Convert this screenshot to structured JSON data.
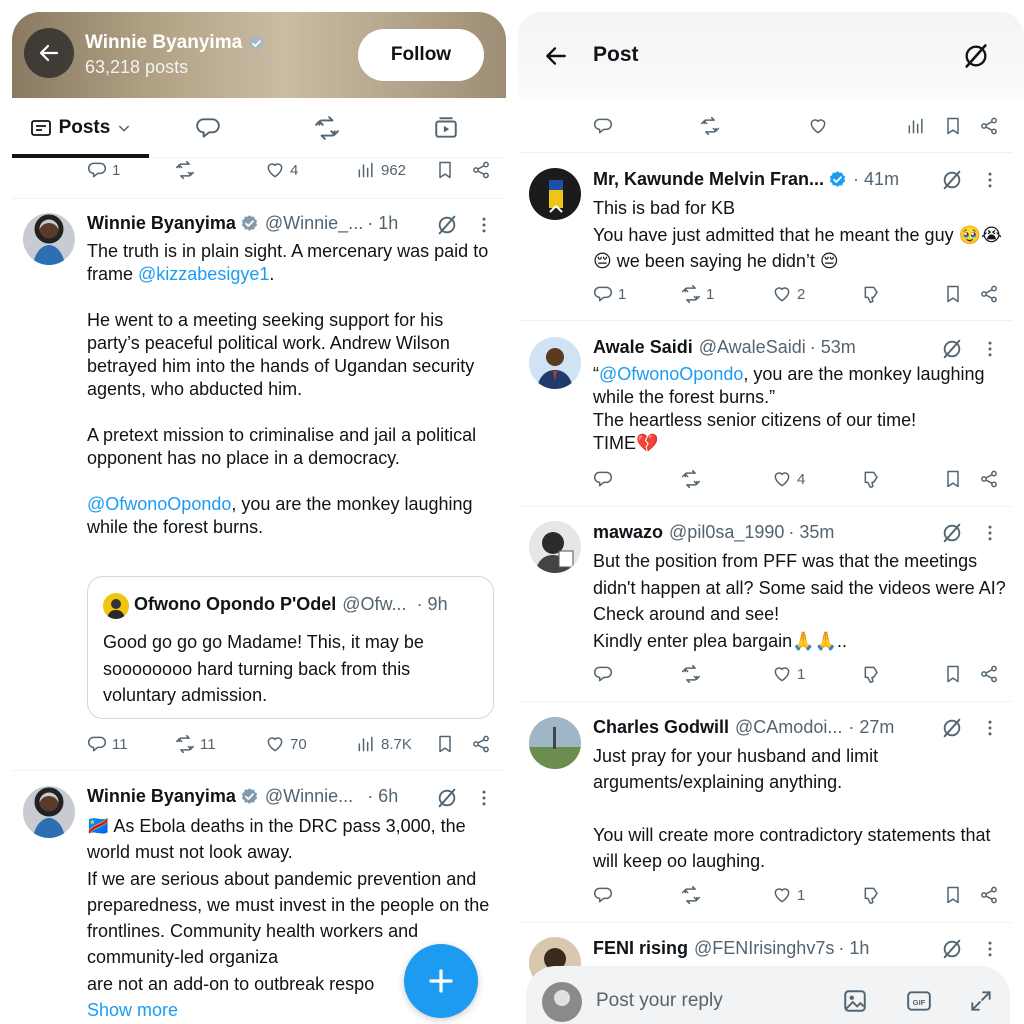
{
  "left": {
    "profile": {
      "name": "Winnie Byanyima",
      "posts_count": "63,218 posts",
      "follow_label": "Follow"
    },
    "tabs": {
      "active_label": "Posts"
    },
    "top_actions": {
      "replies": "1",
      "likes": "4",
      "views": "962"
    },
    "post1": {
      "name": "Winnie Byanyima",
      "handle": "@Winnie_...",
      "time": "· 1h",
      "text_a": "The truth is in plain sight. A mercenary was paid to frame ",
      "mention_a": "@kizzabesigye1",
      "text_a_end": ".",
      "para2": "He went to a meeting seeking support for his party’s peaceful political work. Andrew Wilson betrayed him into the hands of Ugandan security agents, who abducted him.",
      "para3": "A pretext mission to criminalise and jail a political opponent has no place in a democracy.",
      "mention_b": "@OfwonoOpondo",
      "text_b": ", you are the monkey laughing while the forest burns.",
      "quote": {
        "name": "Ofwono Opondo P'Odel",
        "handle": "@Ofw...",
        "time": "· 9h",
        "text": "Good go go go Madame! This, it may be soooooooo hard turning back from this voluntary admission."
      },
      "actions": {
        "replies": "11",
        "reposts": "11",
        "likes": "70",
        "views": "8.7K"
      }
    },
    "post2": {
      "name": "Winnie Byanyima",
      "handle": "@Winnie...",
      "time": "· 6h",
      "flag": "🇨🇩",
      "line1": " As Ebola deaths in the DRC pass 3,000, the world must not look away.",
      "para2": "If we are serious about pandemic prevention and preparedness, we must invest in the people on the frontlines. Community health workers and community-led organiza",
      "para2_end": "are not an add-on to outbreak respo",
      "show_more": "Show more"
    }
  },
  "right": {
    "header": {
      "title": "Post"
    },
    "replies": [
      {
        "name": "Mr, Kawunde Melvin Fran...",
        "handle": "",
        "time": "· 41m",
        "verified": true,
        "text": "This is bad for KB\nYou have just admitted that he meant the guy 🥹😭😔 we been saying he didn’t 😔",
        "replies": "1",
        "reposts": "1",
        "likes": "2"
      },
      {
        "name": "Awale Saidi",
        "handle": "@AwaleSaidi",
        "time": "· 53m",
        "verified": false,
        "mention": "@OfwonoOpondo",
        "text_pre": "“",
        "text_post": ", you are the monkey laughing while the forest burns.”\nThe heartless senior citizens of our time!\nTIME💔",
        "replies": "",
        "reposts": "",
        "likes": "4"
      },
      {
        "name": "mawazo",
        "handle": "@pil0sa_1990",
        "time": "· 35m",
        "verified": false,
        "text": "But the position from PFF was that the meetings didn't happen at all? Some said the videos were AI? Check around and see!\nKindly enter plea bargain🙏🙏..",
        "replies": "",
        "reposts": "",
        "likes": "1"
      },
      {
        "name": "Charles Godwill",
        "handle": "@CAmodoi...",
        "time": "· 27m",
        "verified": false,
        "text": "Just pray for your husband and limit arguments/explaining anything.\n\nYou will create more contradictory statements that will keep oo laughing.",
        "replies": "",
        "reposts": "",
        "likes": "1"
      },
      {
        "name": "FENI rising",
        "handle": "@FENIrisinghv7s",
        "time": "· 1h",
        "verified": false
      }
    ],
    "reply_bar": {
      "placeholder": "Post your reply"
    }
  },
  "colors": {
    "accent": "#1d9bf0",
    "text": "#0f1419",
    "muted": "#536471",
    "verified": "#829aab"
  },
  "icons": [
    "back-arrow-icon",
    "verified-badge-icon",
    "posts-feed-icon",
    "chevron-down-icon",
    "reply-icon",
    "repost-icon",
    "like-icon",
    "views-icon",
    "bookmark-icon",
    "share-icon",
    "grok-icon",
    "more-icon",
    "dislike-icon",
    "compose-plus-icon",
    "image-icon",
    "gif-icon",
    "expand-icon",
    "media-icon"
  ]
}
